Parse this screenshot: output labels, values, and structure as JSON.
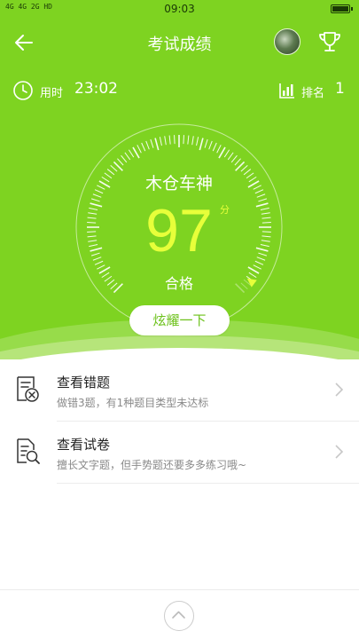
{
  "status_bar": {
    "signal_text": "4G 4G 2G HD",
    "time": "09:03"
  },
  "header": {
    "title": "考试成绩",
    "back_icon": "back-arrow-icon",
    "trophy_icon": "trophy-icon"
  },
  "meta": {
    "time_used_label": "用时",
    "time_used_value": "23:02",
    "rank_label": "排名",
    "rank_value": "1"
  },
  "result": {
    "name": "木仓车神",
    "score": "97",
    "score_unit": "分",
    "grade": "合格",
    "score_fraction": 0.97
  },
  "share_button": {
    "label": "炫耀一下"
  },
  "actions": [
    {
      "title": "查看错题",
      "subtitle": "做错3题，有1种题目类型未达标",
      "icon": "wrong-answers-icon"
    },
    {
      "title": "查看试卷",
      "subtitle": "擅长文字题，但手势题还要多多练习哦~",
      "icon": "review-paper-icon"
    }
  ],
  "colors": {
    "hero_green": "#7ed321",
    "score_yellow": "#e7ff3a",
    "button_text_green": "#6cc11a"
  }
}
